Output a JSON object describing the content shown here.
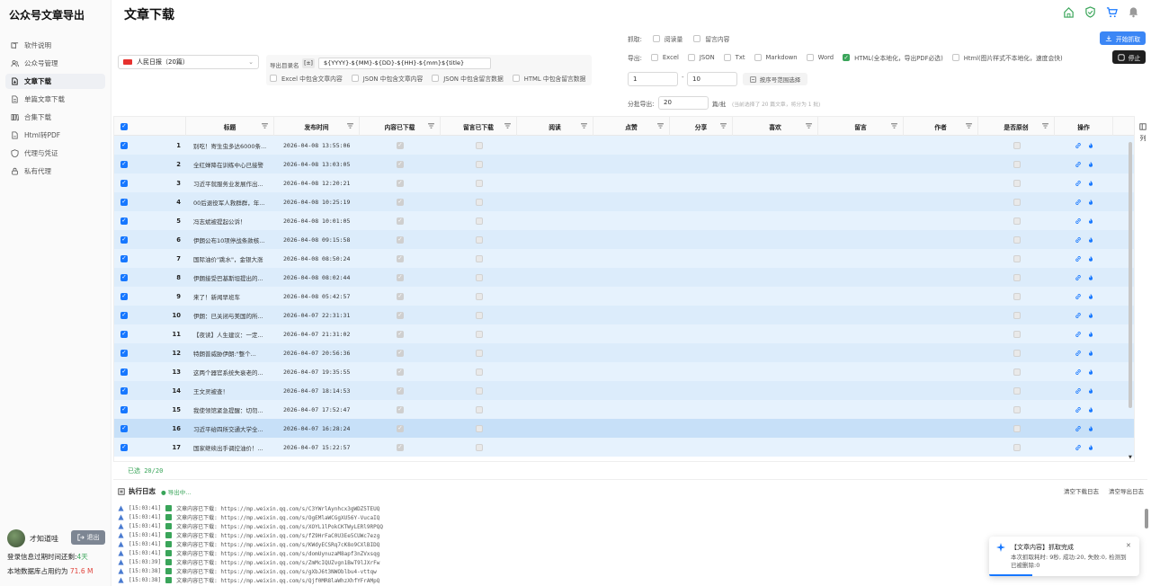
{
  "app": {
    "title": "公众号文章导出"
  },
  "sidebar": {
    "items": [
      {
        "label": "软件说明",
        "icon": "book-icon"
      },
      {
        "label": "公众号管理",
        "icon": "users-icon"
      },
      {
        "label": "文章下载",
        "icon": "file-download-icon",
        "active": true
      },
      {
        "label": "单篇文章下载",
        "icon": "file-icon"
      },
      {
        "label": "合集下载",
        "icon": "collection-icon"
      },
      {
        "label": "Html转PDF",
        "icon": "pdf-icon"
      },
      {
        "label": "代理与凭证",
        "icon": "shield-icon"
      },
      {
        "label": "私有代理",
        "icon": "lock-icon"
      }
    ],
    "user": {
      "name": "才知道哇",
      "logout_label": "退出"
    },
    "login_expire_label": "登录信息过期时间还剩:",
    "login_expire_value": "4天",
    "db_label": "本地数据库占用约为",
    "db_value": "71.6 M"
  },
  "header": {
    "page_title": "文章下载",
    "icons": [
      "home-icon",
      "shield-check-icon",
      "cart-icon",
      "bell-icon"
    ]
  },
  "controls": {
    "account": {
      "label": "人民日报（20篇）"
    },
    "dir": {
      "label": "导出目录名",
      "tag": "[±]",
      "value": "${YYYY}-${MM}-${DD}-${HH}-${mm}${title}",
      "options": [
        {
          "label": "Excel 中包含文章内容",
          "checked": false
        },
        {
          "label": "JSON 中包含文章内容",
          "checked": false
        },
        {
          "label": "JSON 中包含留言数据",
          "checked": false
        },
        {
          "label": "HTML 中包含留言数据",
          "checked": false
        }
      ]
    },
    "fetch": {
      "label": "抓取:",
      "options": [
        {
          "label": "阅读量",
          "checked": false
        },
        {
          "label": "留言内容",
          "checked": false
        }
      ]
    },
    "export": {
      "label": "导出:",
      "options": [
        {
          "label": "Excel",
          "checked": false
        },
        {
          "label": "JSON",
          "checked": false
        },
        {
          "label": "Txt",
          "checked": false
        },
        {
          "label": "Markdown",
          "checked": false
        },
        {
          "label": "Word",
          "checked": false
        },
        {
          "label": "HTML(全本地化，导出PDF必选)",
          "checked": true
        },
        {
          "label": "Html(图片样式不本地化，速度会快)",
          "checked": false
        }
      ]
    },
    "start_label": "开始抓取",
    "stop_label": "停止",
    "range_from": "1",
    "range_to": "10",
    "range_button": "按序号范围选择",
    "batch_label": "分批导出:",
    "batch_value": "20",
    "batch_unit": "篇/批",
    "batch_hint": "(当前选择了 20 篇文章，将分为 1 批)"
  },
  "table": {
    "columns": [
      "标题",
      "发布时间",
      "内容已下载",
      "留言已下载",
      "阅读",
      "点赞",
      "分享",
      "喜欢",
      "留言",
      "作者",
      "是否原创",
      "操作"
    ],
    "rows": [
      {
        "idx": "1",
        "title": "别吃！寄生虫多达6000条...",
        "time": "2026-04-08 13:55:06"
      },
      {
        "idx": "2",
        "title": "全红婵降在训练中心已接警",
        "time": "2026-04-08 13:03:05"
      },
      {
        "idx": "3",
        "title": "习近平就服务业发展作出...",
        "time": "2026-04-08 12:20:21"
      },
      {
        "idx": "4",
        "title": "00后退役军人救群群，年...",
        "time": "2026-04-08 10:25:19"
      },
      {
        "idx": "5",
        "title": "冯志斌被提起公诉！",
        "time": "2026-04-08 10:01:05"
      },
      {
        "idx": "6",
        "title": "伊朗公布10项停战条款核...",
        "time": "2026-04-08 09:15:58"
      },
      {
        "idx": "7",
        "title": "国际油价\"跳水\"，金银大涨",
        "time": "2026-04-08 08:50:24"
      },
      {
        "idx": "8",
        "title": "伊朗接受巴基斯坦提出的...",
        "time": "2026-04-08 08:02:44"
      },
      {
        "idx": "9",
        "title": "来了！新闻早班车",
        "time": "2026-04-08 05:42:57"
      },
      {
        "idx": "10",
        "title": "伊朗：已关闭与美国的所...",
        "time": "2026-04-07 22:31:31"
      },
      {
        "idx": "11",
        "title": "【夜读】人生建议：一定...",
        "time": "2026-04-07 21:31:02"
      },
      {
        "idx": "12",
        "title": "特朗普威胁伊朗:\"整个...",
        "time": "2026-04-07 20:56:36"
      },
      {
        "idx": "13",
        "title": "这两个器官系统失衰老的...",
        "time": "2026-04-07 19:35:55"
      },
      {
        "idx": "14",
        "title": "王文灵被查！",
        "time": "2026-04-07 18:14:53"
      },
      {
        "idx": "15",
        "title": "我使领馆紧急提醒：切勿...",
        "time": "2026-04-07 17:52:47"
      },
      {
        "idx": "16",
        "title": "习近平给四所交通大学全...",
        "time": "2026-04-07 16:28:24"
      },
      {
        "idx": "17",
        "title": "国家继续出手调控油价！...",
        "time": "2026-04-07 15:22:57"
      }
    ],
    "col_settings_label": "列",
    "selected_label": "已选 20/20"
  },
  "log": {
    "title": "执行日志",
    "status": "导出中...",
    "clear_download": "清空下载日志",
    "clear_export": "清空导出日志",
    "lines": [
      {
        "time": "[15:03:41]",
        "text": "文章内容已下载: https://mp.weixin.qq.com/s/C3YWrlAynhcx3gWDZ5TEUQ"
      },
      {
        "time": "[15:03:41]",
        "text": "文章内容已下载: https://mp.weixin.qq.com/s/OgEMlaWCGgXU56Y-VucaIQ"
      },
      {
        "time": "[15:03:41]",
        "text": "文章内容已下载: https://mp.weixin.qq.com/s/XOYL1lPokCKTWyLERl9RPQQ"
      },
      {
        "time": "[15:03:41]",
        "text": "文章内容已下载: https://mp.weixin.qq.com/s/fZ9HrFaC0U3Ee5CUWc7ezg"
      },
      {
        "time": "[15:03:41]",
        "text": "文章内容已下载: https://mp.weixin.qq.com/s/KWdyECSRq7cK8o9CXlBIDQ"
      },
      {
        "time": "[15:03:41]",
        "text": "文章内容已下载: https://mp.weixin.qq.com/s/domUynuzaM8apf3nZVxsqg"
      },
      {
        "time": "[15:03:39]",
        "text": "文章内容已下载: https://mp.weixin.qq.com/s/ZmMcIQUZvgn1BwT9lJXrFw"
      },
      {
        "time": "[15:03:38]",
        "text": "文章内容已下载: https://mp.weixin.qq.com/s/gXbJ6t3NWOblbu4-vttqw"
      },
      {
        "time": "[15:03:38]",
        "text": "文章内容已下载: https://mp.weixin.qq.com/s/Qjf0MR8laWhzXhfYFrAMpQ"
      }
    ]
  },
  "toast": {
    "title": "【文章内容】抓取完成",
    "message": "本次抓取耗时: 9秒, 成功:20, 失败:0, 检测到已被删除:0",
    "progress": 0.29
  },
  "colors": {
    "accent": "#1677ff",
    "success": "#3aa55a",
    "danger": "#e0433b"
  }
}
